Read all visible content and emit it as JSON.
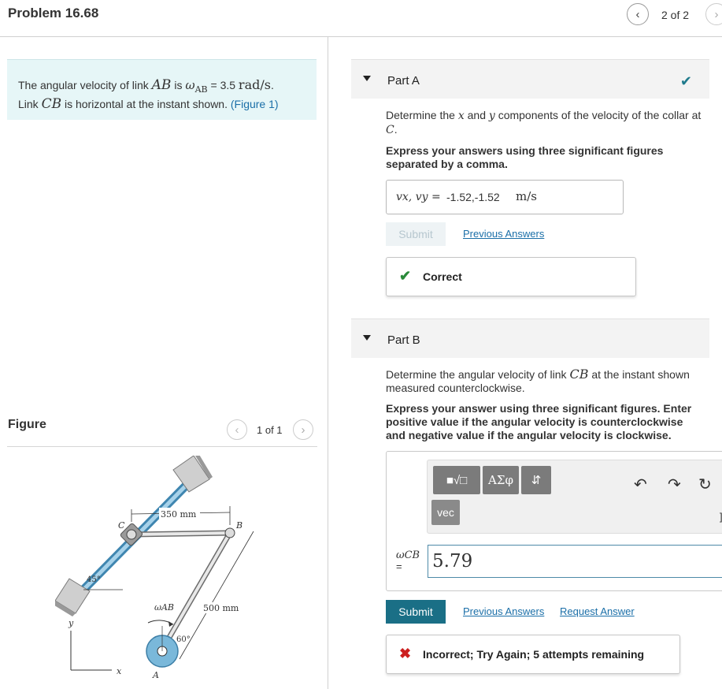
{
  "header": {
    "title": "Problem 16.68",
    "page_count": "2 of 2",
    "prev_icon": "chevron-left-icon",
    "next_icon": "chevron-right-icon"
  },
  "problem": {
    "text1": "The angular velocity of link",
    "link_ab": "AB",
    "text2": "is",
    "omega": "ω",
    "omega_sub": "AB",
    "equals": "= 3.5",
    "units": "rad/s",
    "text3": ".",
    "text4": "Link",
    "link_cb": "CB",
    "text5": "is horizontal at the instant shown.",
    "figure_link": "(Figure 1)"
  },
  "figure": {
    "label": "Figure",
    "count": "1 of 1",
    "labels": {
      "dim_350": "350 mm",
      "dim_500": "500 mm",
      "C": "C",
      "B": "B",
      "A": "A",
      "angle45": "45°",
      "angle60": "60°",
      "omega_ab": "ωAB",
      "axis_y": "y",
      "axis_x": "x"
    }
  },
  "partA": {
    "title": "Part A",
    "status_icon": "checkmark-icon",
    "question_prefix": "Determine the",
    "var_x": "x",
    "question_mid": "and",
    "var_y": "y",
    "question_suffix": "components of the velocity of the collar at",
    "var_c": "C",
    "question_end": ".",
    "instruction": "Express your answers using three significant figures separated by a comma.",
    "answer_label": "vx, vy =",
    "answer_value": "-1.52,-1.52",
    "answer_units": "m/s",
    "submit": "Submit",
    "previous_answers": "Previous Answers",
    "feedback": "Correct"
  },
  "partB": {
    "title": "Part B",
    "question_prefix": "Determine the angular velocity of link",
    "var_cb": "CB",
    "question_suffix": "at the instant shown measured counterclockwise.",
    "instruction": "Express your answer using three significant figures. Enter positive value if the angular velocity is counterclockwise and negative value if the angular velocity is clockwise.",
    "toolbar": {
      "templates": "■√□",
      "greek": "ΑΣφ",
      "arrows": "⇵",
      "vec": "vec",
      "extra": "]"
    },
    "omega_label": "ωCB",
    "equals": "=",
    "answer_value": "5.79",
    "submit": "Submit",
    "previous_answers": "Previous Answers",
    "request_answer": "Request Answer",
    "feedback": "Incorrect; Try Again; 5 attempts remaining"
  },
  "colors": {
    "problem_bg": "#e6f6f7",
    "link": "#1b6fa8",
    "submit_bg": "#1a6f86",
    "correct": "#2a8a3a",
    "incorrect": "#cc1f1f",
    "link_bar": "#6aaccd"
  }
}
